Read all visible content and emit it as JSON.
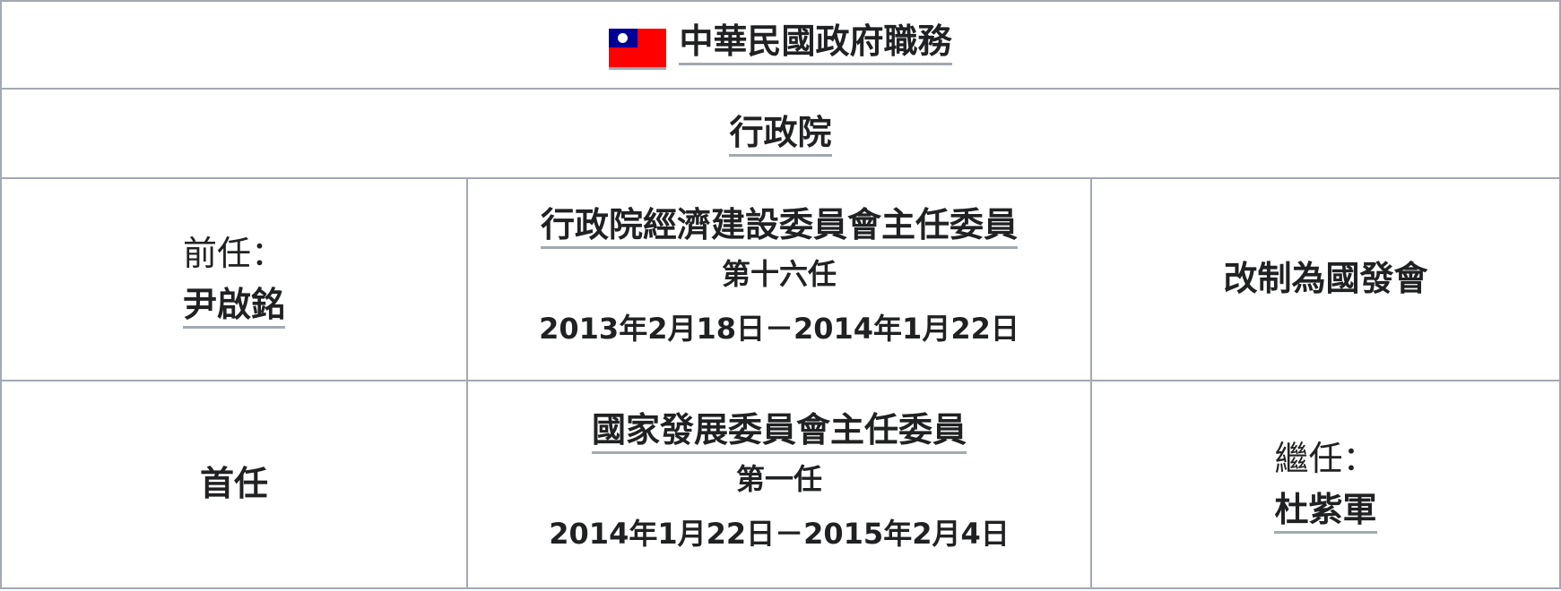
{
  "header": {
    "title": "中華民國政府職務",
    "flag_icon": "flag-of-republic-of-china"
  },
  "organization": "行政院",
  "rows": [
    {
      "left_label": "前任：",
      "left_name": "尹啟銘",
      "office": "行政院經濟建設委員會主任委員",
      "term_number": "第十六任",
      "term_dates": "2013年2月18日－2014年1月22日",
      "right_text": "改制為國發會"
    },
    {
      "left_text": "首任",
      "office": "國家發展委員會主任委員",
      "term_number": "第一任",
      "term_dates": "2014年1月22日－2015年2月4日",
      "right_label": "繼任：",
      "right_name": "杜紫軍"
    }
  ],
  "colors": {
    "border": "#a2a9b1",
    "flag_red": "#fe0000",
    "flag_blue": "#000095"
  }
}
